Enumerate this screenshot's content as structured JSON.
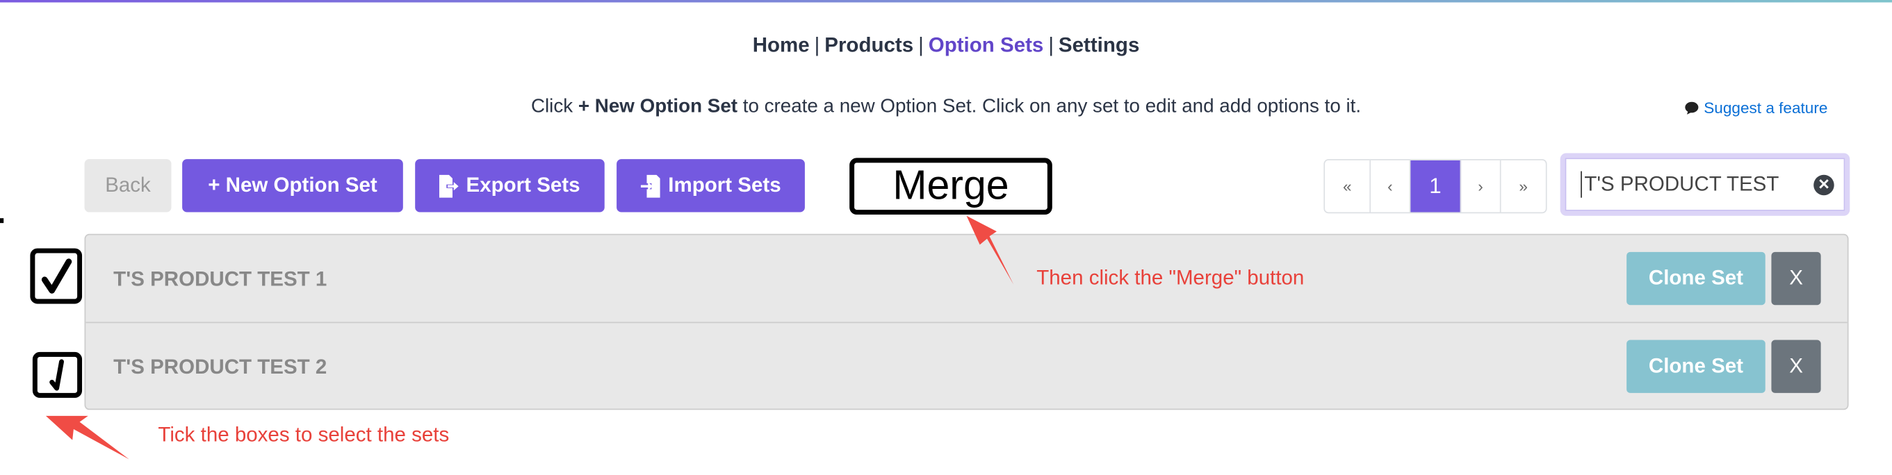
{
  "nav": {
    "items": [
      {
        "label": "Home",
        "active": false
      },
      {
        "label": "Products",
        "active": false
      },
      {
        "label": "Option Sets",
        "active": true
      },
      {
        "label": "Settings",
        "active": false
      }
    ],
    "separator": "|"
  },
  "instructions": {
    "prefix": "Click ",
    "bold": "+ New Option Set",
    "suffix": " to create a new Option Set. Click on any set to edit and add options to it."
  },
  "suggest": {
    "label": "Suggest a feature",
    "icon": "speech-bubble-icon"
  },
  "toolbar": {
    "back": "Back",
    "new_set": "+ New Option Set",
    "export": "Export Sets",
    "import": "Import Sets"
  },
  "pagination": {
    "first": "«",
    "prev": "‹",
    "current": "1",
    "next": "›",
    "last": "»"
  },
  "search": {
    "value": "T'S PRODUCT TEST",
    "clear_icon": "clear-circle-icon"
  },
  "sets": [
    {
      "name": "T'S PRODUCT TEST 1",
      "clone": "Clone Set",
      "delete": "X",
      "checked": true
    },
    {
      "name": "T'S PRODUCT TEST 2",
      "clone": "Clone Set",
      "delete": "X",
      "checked": true
    }
  ],
  "annotations": {
    "merge": "Merge",
    "merge_hint": "Then click the \"Merge\" button",
    "tick_hint": "Tick the boxes to select the sets"
  },
  "colors": {
    "accent": "#7459e0",
    "active_nav": "#6246c9",
    "clone": "#87c3d0",
    "delete": "#6c757d",
    "annotation": "#e8413a",
    "link": "#0a6fd6"
  }
}
